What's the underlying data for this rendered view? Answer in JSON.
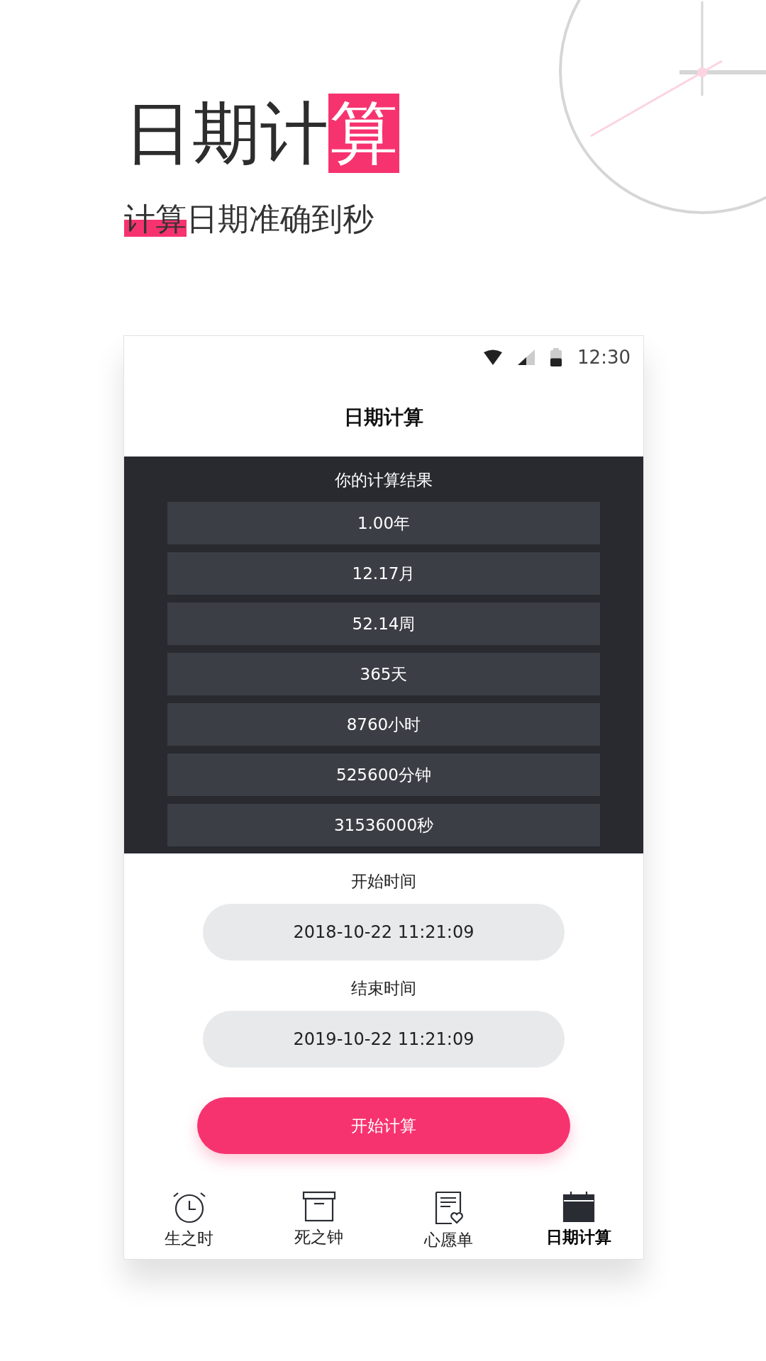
{
  "headline": [
    {
      "text": "日期计",
      "highlighted": false
    },
    {
      "text": "算",
      "highlighted": true
    }
  ],
  "tagline": [
    {
      "text": "计算",
      "highlighted": true
    },
    {
      "text": "日期准确到秒",
      "highlighted": false
    }
  ],
  "status_bar": {
    "time": "12:30",
    "battery": {
      "level": 0.5
    }
  },
  "app_bar": {
    "title": "日期计算"
  },
  "results": {
    "title": "你的计算结果",
    "items": [
      "1.00年",
      "12.17月",
      "52.14周",
      "365天",
      "8760小时",
      "525600分钟",
      "31536000秒"
    ]
  },
  "start": {
    "label": "开始时间",
    "value": "2018-10-22 11:21:09"
  },
  "end": {
    "label": "结束时间",
    "value": "2019-10-22 11:21:09"
  },
  "action": {
    "label": "开始计算"
  },
  "nav": [
    {
      "label": "生之时",
      "kind": "alarm",
      "selected": false
    },
    {
      "label": "死之钟",
      "kind": "box",
      "selected": false
    },
    {
      "label": "心愿单",
      "kind": "wish",
      "selected": false
    },
    {
      "label": "日期计算",
      "kind": "calendar",
      "selected": true
    }
  ]
}
